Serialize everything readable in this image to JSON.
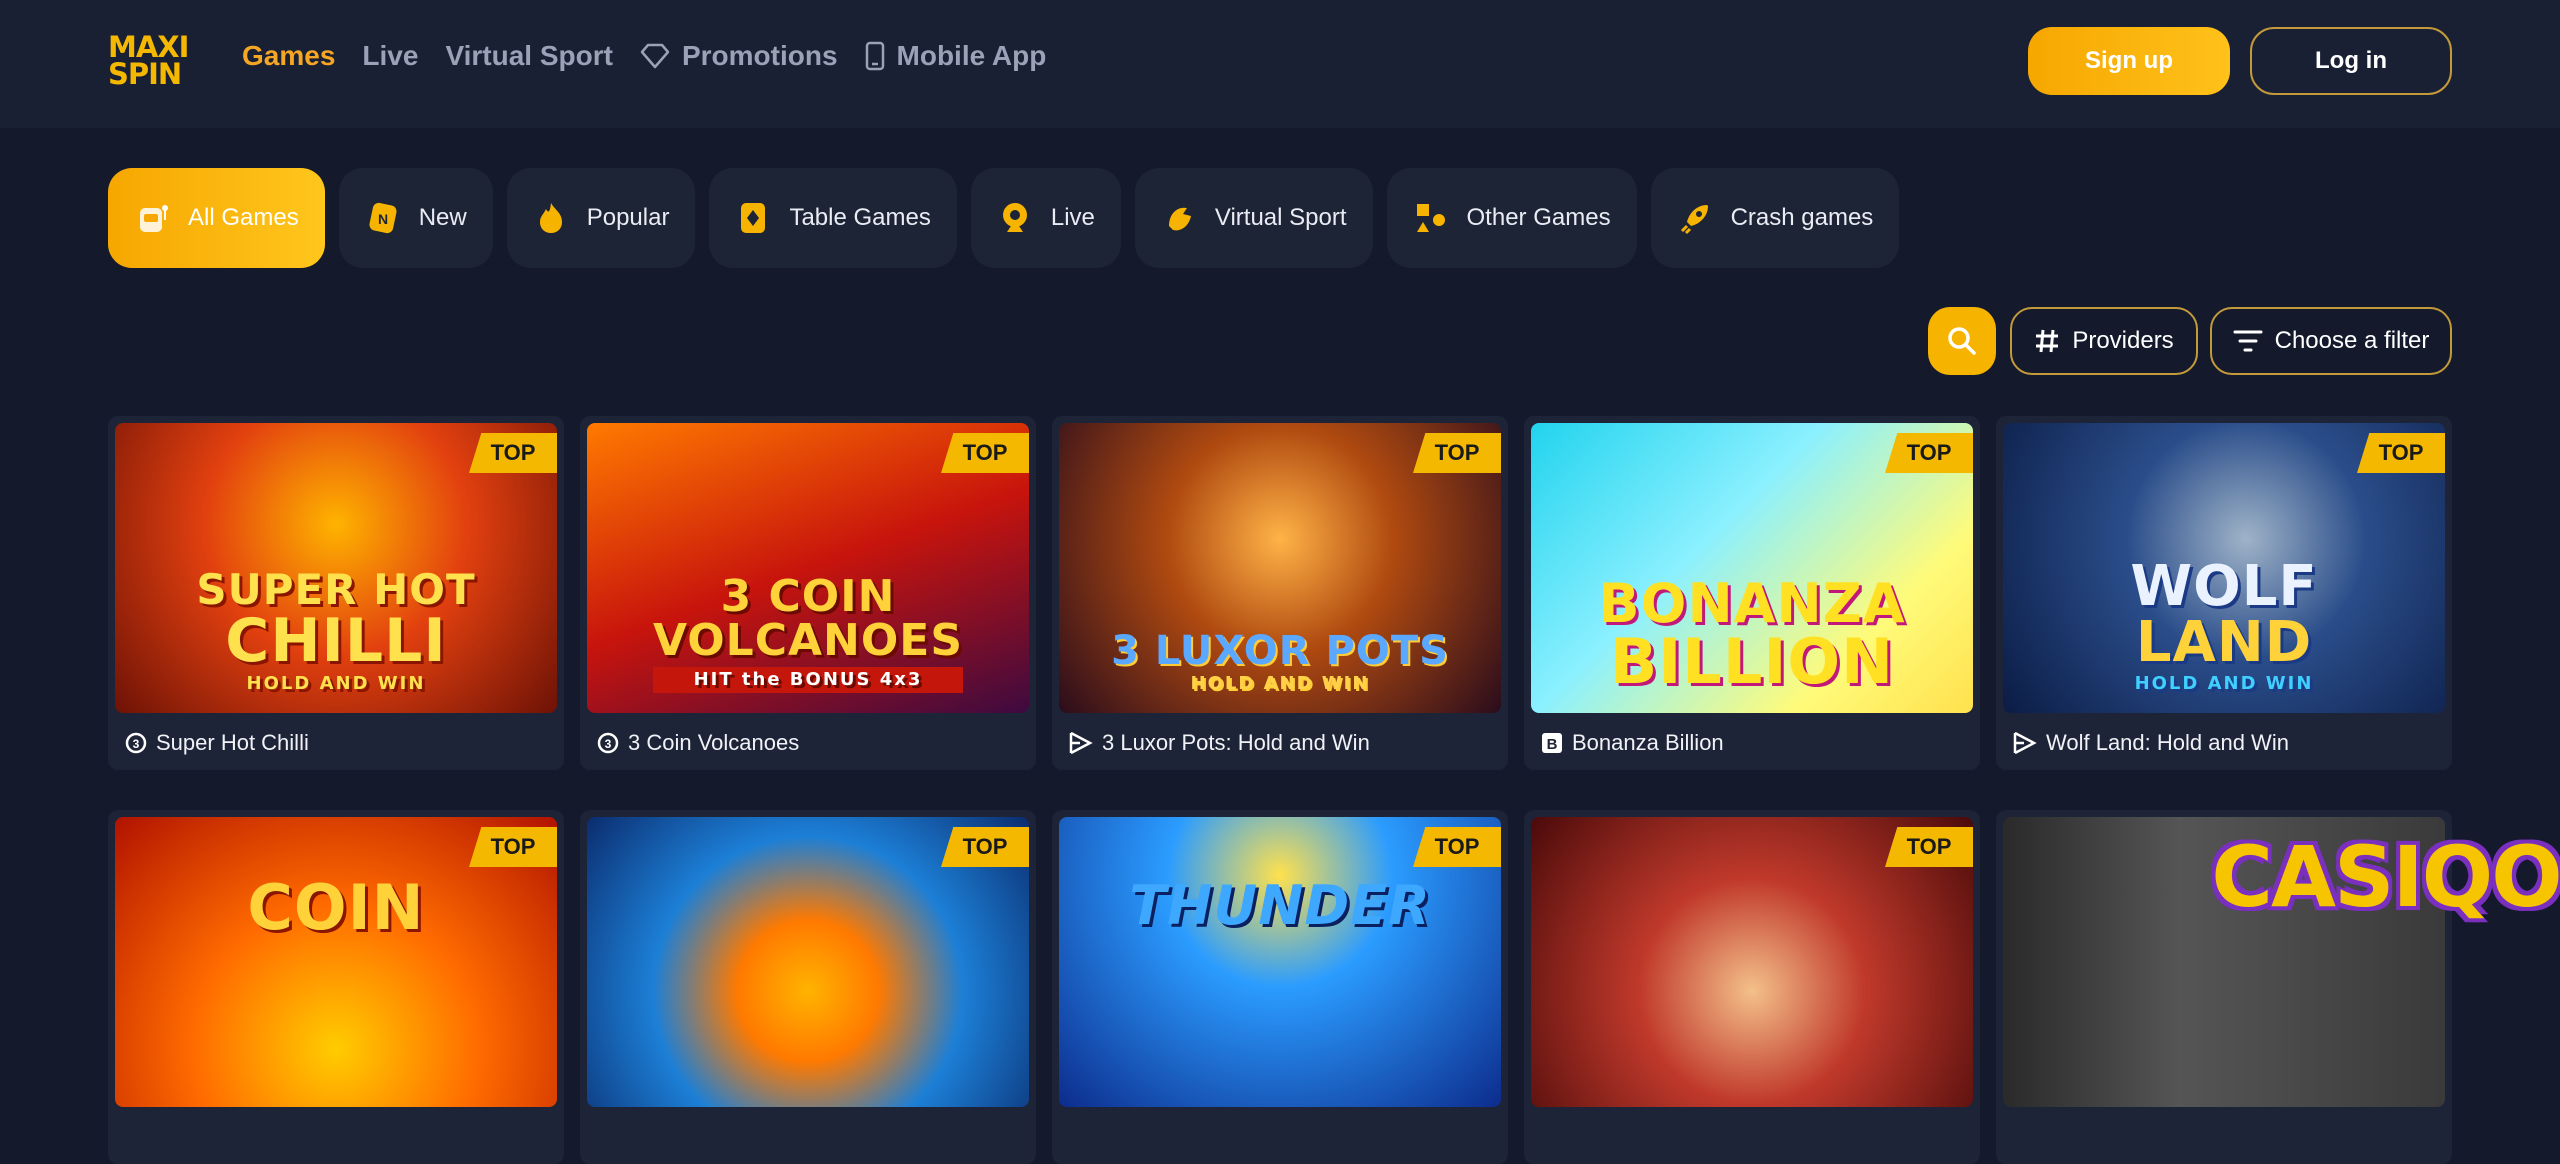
{
  "brand": {
    "logo_line1": "MAXI",
    "logo_line2": "SPIN"
  },
  "nav": [
    {
      "label": "Games",
      "active": true
    },
    {
      "label": "Live"
    },
    {
      "label": "Virtual Sport"
    },
    {
      "label": "Promotions",
      "icon": "diamond-icon"
    },
    {
      "label": "Mobile App",
      "icon": "phone-icon"
    }
  ],
  "auth": {
    "signup": "Sign up",
    "login": "Log in"
  },
  "categories": [
    {
      "label": "All Games",
      "icon": "slot-machine-icon",
      "active": true
    },
    {
      "label": "New",
      "icon": "new-icon"
    },
    {
      "label": "Popular",
      "icon": "fire-icon"
    },
    {
      "label": "Table Games",
      "icon": "card-icon"
    },
    {
      "label": "Live",
      "icon": "webcam-icon"
    },
    {
      "label": "Virtual Sport",
      "icon": "virtual-sport-icon"
    },
    {
      "label": "Other Games",
      "icon": "shapes-icon"
    },
    {
      "label": "Crash games",
      "icon": "rocket-icon"
    }
  ],
  "filters": {
    "providers": "Providers",
    "choose": "Choose a filter"
  },
  "games": [
    {
      "title": "Super Hot Chilli",
      "badge": "TOP",
      "art1": "SUPER HOT",
      "art2": "CHILLI",
      "art3": "HOLD AND WIN"
    },
    {
      "title": "3 Coin Volcanoes",
      "badge": "TOP",
      "art1": "3 COIN",
      "art2": "VOLCANOES",
      "art3": "HIT the BONUS 4x3"
    },
    {
      "title": "3 Luxor Pots: Hold and Win",
      "badge": "TOP",
      "art1": "3 LUXOR POTS",
      "art2": "",
      "art3": "HOLD AND WIN"
    },
    {
      "title": "Bonanza Billion",
      "badge": "TOP",
      "art1": "BONANZA",
      "art2": "BILLION",
      "art3": ""
    },
    {
      "title": "Wolf Land: Hold and Win",
      "badge": "TOP",
      "art1": "WOLF",
      "art2": "LAND",
      "art3": "HOLD AND WIN"
    },
    {
      "title": "",
      "badge": "TOP",
      "art1": "COIN",
      "art2": "",
      "art3": ""
    },
    {
      "title": "",
      "badge": "TOP",
      "art1": "",
      "art2": "",
      "art3": ""
    },
    {
      "title": "",
      "badge": "TOP",
      "art1": "THUNDER",
      "art2": "",
      "art3": ""
    },
    {
      "title": "",
      "badge": "TOP",
      "art1": "",
      "art2": "",
      "art3": ""
    },
    {
      "title": "",
      "badge": "",
      "art1": "",
      "art2": "",
      "art3": ""
    }
  ],
  "watermark": "CASIQO",
  "colors": {
    "accent": "#f5b800",
    "bg": "#141a2c",
    "header": "#1a2033",
    "card": "#1e2437"
  }
}
